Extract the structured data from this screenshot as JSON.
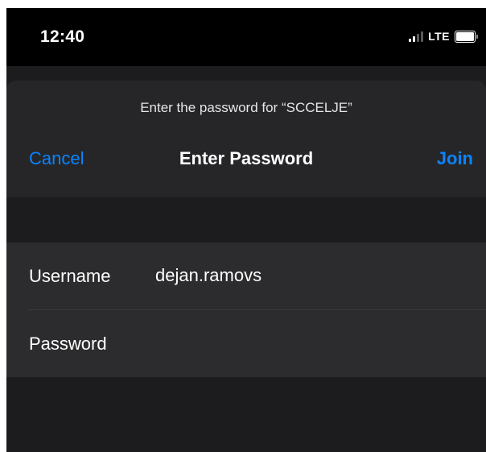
{
  "status_bar": {
    "time": "12:40",
    "network": "LTE",
    "icons": [
      "cellular-signal-icon",
      "battery-icon"
    ]
  },
  "dialog": {
    "prompt": "Enter the password for “SCCELJE”",
    "title": "Enter Password",
    "cancel_label": "Cancel",
    "join_label": "Join"
  },
  "form": {
    "username_label": "Username",
    "username_value": "dejan.ramovs",
    "password_label": "Password",
    "password_value": ""
  },
  "colors": {
    "accent": "#0a84ff",
    "background": "#1c1c1e",
    "group_background": "#2c2c2e",
    "text": "#ffffff"
  }
}
